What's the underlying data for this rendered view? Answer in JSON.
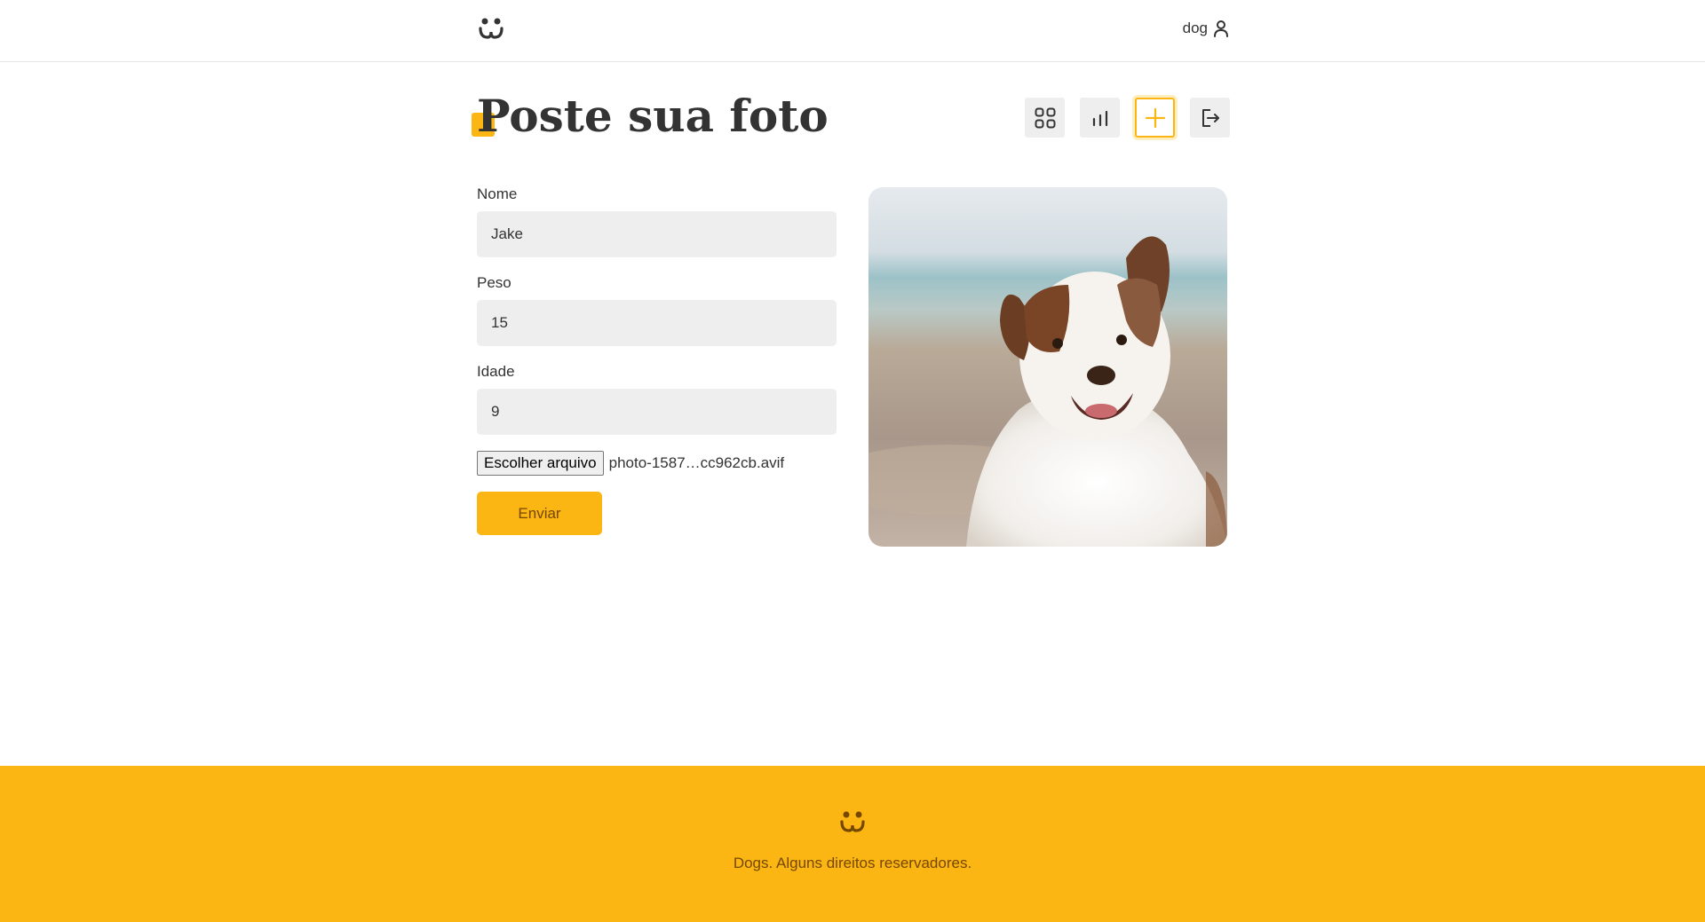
{
  "header": {
    "logo_icon": "dog-face-icon",
    "user_label": "dog",
    "user_icon": "user-icon"
  },
  "page": {
    "title": "Poste sua foto"
  },
  "nav": {
    "items": [
      {
        "icon": "grid-icon",
        "active": false
      },
      {
        "icon": "bar-chart-icon",
        "active": false
      },
      {
        "icon": "plus-icon",
        "active": true
      },
      {
        "icon": "logout-icon",
        "active": false
      }
    ],
    "accent": "#fbb613"
  },
  "form": {
    "name_label": "Nome",
    "name_value": "Jake",
    "weight_label": "Peso",
    "weight_value": "15",
    "age_label": "Idade",
    "age_value": "9",
    "file_button": "Escolher arquivo",
    "file_name": "photo-1587…cc962cb.avif",
    "submit_label": "Enviar"
  },
  "preview": {
    "subject": "dog-photo"
  },
  "footer": {
    "logo_icon": "dog-face-icon",
    "text": "Dogs. Alguns direitos reservadores.",
    "background": "#fbb613"
  }
}
